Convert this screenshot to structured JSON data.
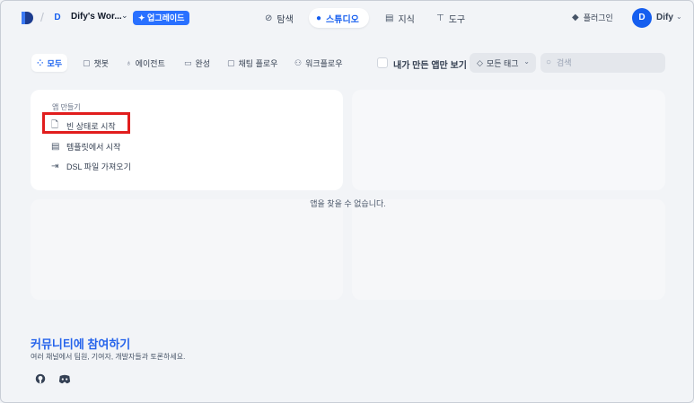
{
  "header": {
    "workspace_initial": "D",
    "workspace_name": "Dify's Wor...",
    "upgrade_label": "업그레이드",
    "nav": {
      "explore": "탐색",
      "studio": "스튜디오",
      "knowledge": "지식",
      "tools": "도구"
    },
    "plugins": "플러그인",
    "user_initial": "D",
    "user_name": "Dify"
  },
  "filters": {
    "tabs": {
      "all": "모두",
      "chatbot": "챗봇",
      "agent": "에이전트",
      "completion": "완성",
      "chatflow": "채팅 플로우",
      "workflow": "워크플로우"
    },
    "my_apps_only": "내가 만든 앱만 보기",
    "tag_select": "모든 태그",
    "search_placeholder": "검색"
  },
  "create": {
    "title": "앱 만들기",
    "blank": "빈 상태로 시작",
    "template": "템플릿에서 시작",
    "dsl": "DSL 파일 가져오기"
  },
  "empty_text": "앱을 찾을 수 없습니다.",
  "community": {
    "title": "커뮤니티에 참여하기",
    "desc": "여러 채널에서 팀원, 기여자, 개발자들과 토론하세요."
  },
  "colors": {
    "accent": "#155eef",
    "highlight": "#e11d1d",
    "community": "#2563eb"
  }
}
